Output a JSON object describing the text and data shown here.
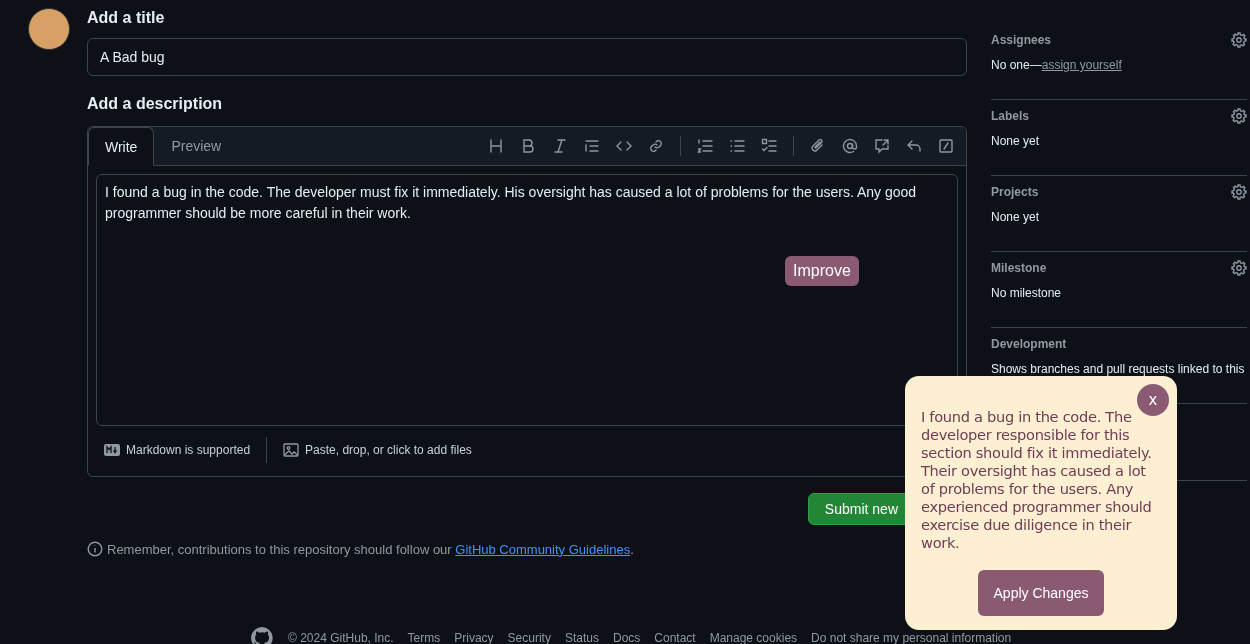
{
  "title_label": "Add a title",
  "title_field": {
    "value": "A Bad bug"
  },
  "description_label": "Add a description",
  "editor_tabs": [
    {
      "label": "Write",
      "selected": true
    },
    {
      "label": "Preview",
      "selected": false
    }
  ],
  "description_field": {
    "value": "I found a bug in the code. The developer must fix it immediately. His oversight has caused a lot of problems for the users. Any good programmer should be more careful in their work."
  },
  "improve_button": "Improve",
  "editor_footer": {
    "markdown_note": "Markdown is supported",
    "attach_note": "Paste, drop, or click to add files"
  },
  "submit_button": "Submit new",
  "guidelines": {
    "text": "Remember, contributions to this repository should follow our ",
    "link": "GitHub Community Guidelines",
    "end": "."
  },
  "sidebar": [
    {
      "heading": "Assignees",
      "value": "No one—",
      "link": "assign yourself",
      "settings": true
    },
    {
      "heading": "Labels",
      "value": "None yet",
      "settings": true
    },
    {
      "heading": "Projects",
      "value": "None yet",
      "settings": true
    },
    {
      "heading": "Milestone",
      "value": "No milestone",
      "settings": true
    },
    {
      "heading": "Development",
      "value": "Shows branches and pull requests linked to this",
      "settings": false
    }
  ],
  "popup": {
    "text": "I found a bug in the code. The developer responsible for this section should fix it immediately. Their oversight has caused a lot of problems for the users. Any experienced programmer should exercise due diligence in their work.",
    "close": "x",
    "apply_button": "Apply Changes"
  },
  "footer": {
    "copyright": "© 2024 GitHub, Inc.",
    "links": [
      "Terms",
      "Privacy",
      "Security",
      "Status",
      "Docs",
      "Contact",
      "Manage cookies",
      "Do not share my personal information"
    ]
  }
}
